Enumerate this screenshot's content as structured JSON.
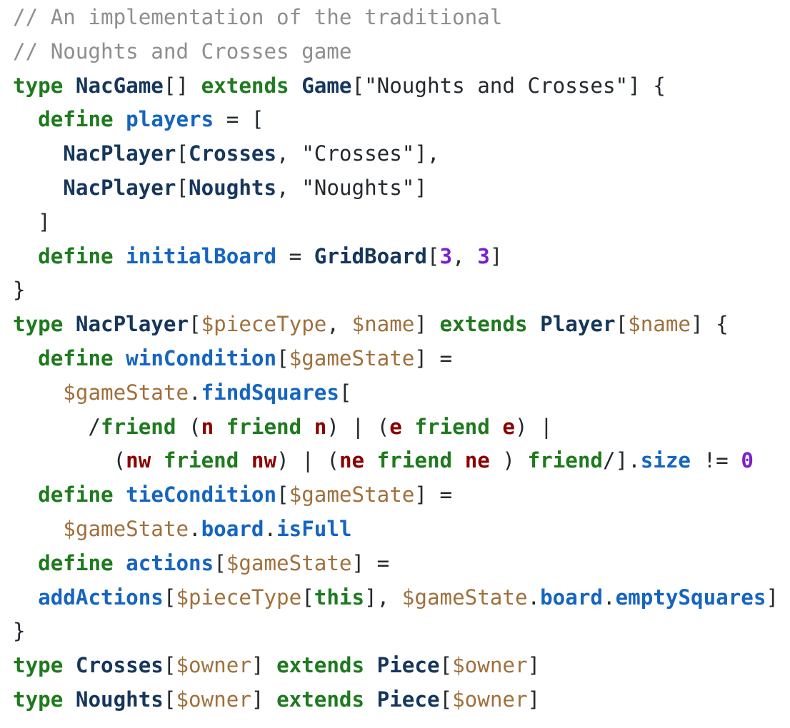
{
  "colors": {
    "keyword": "#1f7a1f",
    "type": "#16365c",
    "function": "#1565c0",
    "variable": "#a0703c",
    "number": "#7b1fd4",
    "direction": "#8b0000",
    "comment": "#8e8e8e",
    "text": "#24292e"
  },
  "lines": [
    [
      [
        "cm",
        "// An implementation of the traditional"
      ]
    ],
    [
      [
        "cm",
        "// Noughts and Crosses game"
      ]
    ],
    [
      [
        "kw",
        "type"
      ],
      [
        "pun",
        " "
      ],
      [
        "ty",
        "NacGame"
      ],
      [
        "pun",
        "[] "
      ],
      [
        "kw",
        "extends"
      ],
      [
        "pun",
        " "
      ],
      [
        "ty",
        "Game"
      ],
      [
        "pun",
        "["
      ],
      [
        "str",
        "\"Noughts and Crosses\""
      ],
      [
        "pun",
        "] {"
      ]
    ],
    [
      [
        "pun",
        "  "
      ],
      [
        "kw",
        "define"
      ],
      [
        "pun",
        " "
      ],
      [
        "fn",
        "players"
      ],
      [
        "pun",
        " = ["
      ]
    ],
    [
      [
        "pun",
        "    "
      ],
      [
        "ty",
        "NacPlayer"
      ],
      [
        "pun",
        "["
      ],
      [
        "ty",
        "Crosses"
      ],
      [
        "pun",
        ", "
      ],
      [
        "str",
        "\"Crosses\""
      ],
      [
        "pun",
        "],"
      ]
    ],
    [
      [
        "pun",
        "    "
      ],
      [
        "ty",
        "NacPlayer"
      ],
      [
        "pun",
        "["
      ],
      [
        "ty",
        "Noughts"
      ],
      [
        "pun",
        ", "
      ],
      [
        "str",
        "\"Noughts\""
      ],
      [
        "pun",
        "]"
      ]
    ],
    [
      [
        "pun",
        "  ]"
      ]
    ],
    [
      [
        "pun",
        "  "
      ],
      [
        "kw",
        "define"
      ],
      [
        "pun",
        " "
      ],
      [
        "fn",
        "initialBoard"
      ],
      [
        "pun",
        " = "
      ],
      [
        "ty",
        "GridBoard"
      ],
      [
        "pun",
        "["
      ],
      [
        "num",
        "3"
      ],
      [
        "pun",
        ", "
      ],
      [
        "num",
        "3"
      ],
      [
        "pun",
        "]"
      ]
    ],
    [
      [
        "pun",
        "}"
      ]
    ],
    [
      [
        "kw",
        "type"
      ],
      [
        "pun",
        " "
      ],
      [
        "ty",
        "NacPlayer"
      ],
      [
        "pun",
        "["
      ],
      [
        "var",
        "$pieceType"
      ],
      [
        "pun",
        ", "
      ],
      [
        "var",
        "$name"
      ],
      [
        "pun",
        "] "
      ],
      [
        "kw",
        "extends"
      ],
      [
        "pun",
        " "
      ],
      [
        "ty",
        "Player"
      ],
      [
        "pun",
        "["
      ],
      [
        "var",
        "$name"
      ],
      [
        "pun",
        "] {"
      ]
    ],
    [
      [
        "pun",
        "  "
      ],
      [
        "kw",
        "define"
      ],
      [
        "pun",
        " "
      ],
      [
        "fn",
        "winCondition"
      ],
      [
        "pun",
        "["
      ],
      [
        "var",
        "$gameState"
      ],
      [
        "pun",
        "] ="
      ]
    ],
    [
      [
        "pun",
        "    "
      ],
      [
        "var",
        "$gameState"
      ],
      [
        "pun",
        "."
      ],
      [
        "fn",
        "findSquares"
      ],
      [
        "pun",
        "["
      ]
    ],
    [
      [
        "pun",
        "      /"
      ],
      [
        "kw",
        "friend"
      ],
      [
        "pun",
        " ("
      ],
      [
        "dir",
        "n"
      ],
      [
        "pun",
        " "
      ],
      [
        "kw",
        "friend"
      ],
      [
        "pun",
        " "
      ],
      [
        "dir",
        "n"
      ],
      [
        "pun",
        ") | ("
      ],
      [
        "dir",
        "e"
      ],
      [
        "pun",
        " "
      ],
      [
        "kw",
        "friend"
      ],
      [
        "pun",
        " "
      ],
      [
        "dir",
        "e"
      ],
      [
        "pun",
        ") |"
      ]
    ],
    [
      [
        "pun",
        "        ("
      ],
      [
        "dir",
        "nw"
      ],
      [
        "pun",
        " "
      ],
      [
        "kw",
        "friend"
      ],
      [
        "pun",
        " "
      ],
      [
        "dir",
        "nw"
      ],
      [
        "pun",
        ") | ("
      ],
      [
        "dir",
        "ne"
      ],
      [
        "pun",
        " "
      ],
      [
        "kw",
        "friend"
      ],
      [
        "pun",
        " "
      ],
      [
        "dir",
        "ne"
      ],
      [
        "pun",
        " ) "
      ],
      [
        "kw",
        "friend"
      ],
      [
        "pun",
        "/]."
      ],
      [
        "fn",
        "size"
      ],
      [
        "pun",
        " != "
      ],
      [
        "num",
        "0"
      ]
    ],
    [
      [
        "pun",
        "  "
      ],
      [
        "kw",
        "define"
      ],
      [
        "pun",
        " "
      ],
      [
        "fn",
        "tieCondition"
      ],
      [
        "pun",
        "["
      ],
      [
        "var",
        "$gameState"
      ],
      [
        "pun",
        "] ="
      ]
    ],
    [
      [
        "pun",
        "    "
      ],
      [
        "var",
        "$gameState"
      ],
      [
        "pun",
        "."
      ],
      [
        "fn",
        "board"
      ],
      [
        "pun",
        "."
      ],
      [
        "fn",
        "isFull"
      ]
    ],
    [
      [
        "pun",
        "  "
      ],
      [
        "kw",
        "define"
      ],
      [
        "pun",
        " "
      ],
      [
        "fn",
        "actions"
      ],
      [
        "pun",
        "["
      ],
      [
        "var",
        "$gameState"
      ],
      [
        "pun",
        "] ="
      ]
    ],
    [
      [
        "pun",
        "  "
      ],
      [
        "fn",
        "addActions"
      ],
      [
        "pun",
        "["
      ],
      [
        "var",
        "$pieceType"
      ],
      [
        "pun",
        "["
      ],
      [
        "th",
        "this"
      ],
      [
        "pun",
        "], "
      ],
      [
        "var",
        "$gameState"
      ],
      [
        "pun",
        "."
      ],
      [
        "fn",
        "board"
      ],
      [
        "pun",
        "."
      ],
      [
        "fn",
        "emptySquares"
      ],
      [
        "pun",
        "]"
      ]
    ],
    [
      [
        "pun",
        "}"
      ]
    ],
    [
      [
        "kw",
        "type"
      ],
      [
        "pun",
        " "
      ],
      [
        "ty",
        "Crosses"
      ],
      [
        "pun",
        "["
      ],
      [
        "var",
        "$owner"
      ],
      [
        "pun",
        "] "
      ],
      [
        "kw",
        "extends"
      ],
      [
        "pun",
        " "
      ],
      [
        "ty",
        "Piece"
      ],
      [
        "pun",
        "["
      ],
      [
        "var",
        "$owner"
      ],
      [
        "pun",
        "]"
      ]
    ],
    [
      [
        "kw",
        "type"
      ],
      [
        "pun",
        " "
      ],
      [
        "ty",
        "Noughts"
      ],
      [
        "pun",
        "["
      ],
      [
        "var",
        "$owner"
      ],
      [
        "pun",
        "] "
      ],
      [
        "kw",
        "extends"
      ],
      [
        "pun",
        " "
      ],
      [
        "ty",
        "Piece"
      ],
      [
        "pun",
        "["
      ],
      [
        "var",
        "$owner"
      ],
      [
        "pun",
        "]"
      ]
    ]
  ]
}
